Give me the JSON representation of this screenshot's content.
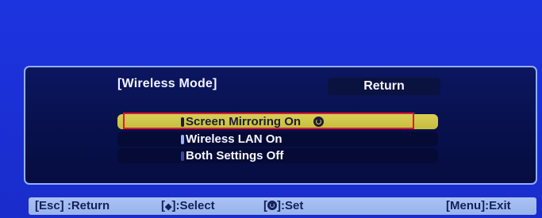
{
  "menu": {
    "title": "[Wireless Mode]",
    "return_label": "Return",
    "options": [
      {
        "label": "Screen Mirroring On",
        "selected": true
      },
      {
        "label": "Wireless LAN On",
        "selected": false
      },
      {
        "label": "Both Settings Off",
        "selected": false
      }
    ]
  },
  "footer": {
    "esc": "[Esc] :Return",
    "select_prefix": "[",
    "select_glyph": "◆",
    "select_suffix": "]:Select",
    "set_prefix": "[",
    "set_suffix": "]:Set",
    "menu_exit": "[Menu]:Exit"
  },
  "colors": {
    "background": "#1a2fd6",
    "panel": "#07104a",
    "selected_option": "#d8cf55",
    "highlight_outline": "#e0182c",
    "footer": "#a9c2f2"
  },
  "icons": {
    "set": "enter-icon",
    "select": "up-down-icon"
  }
}
